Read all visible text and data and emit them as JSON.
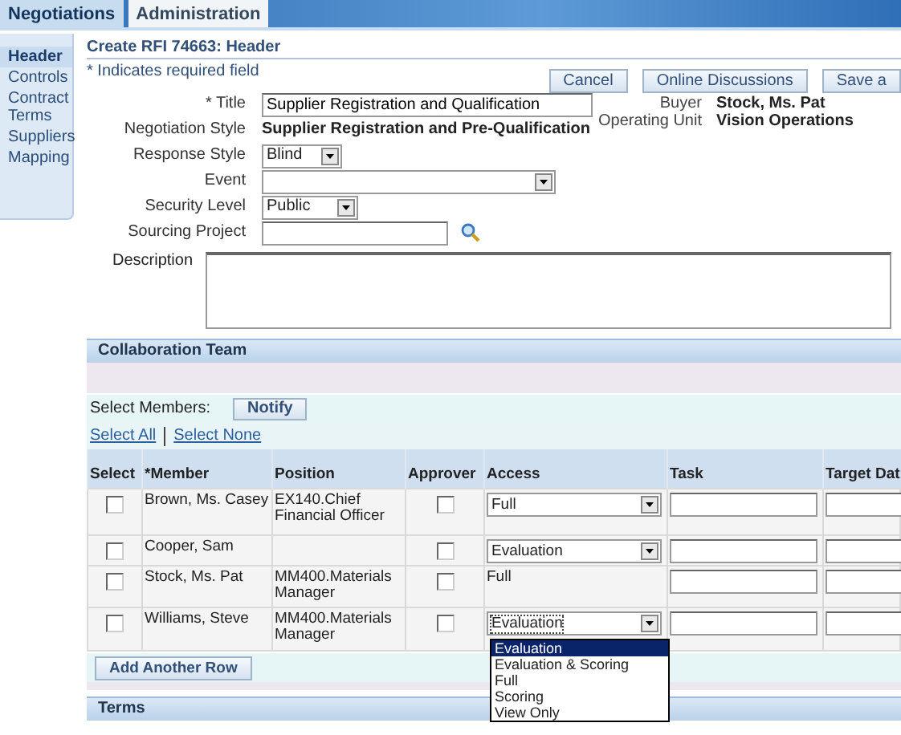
{
  "tabs": [
    {
      "label": "Negotiations",
      "selected": true
    },
    {
      "label": "Administration",
      "selected": false
    }
  ],
  "sidebar": {
    "items": [
      {
        "label": "Header",
        "selected": true
      },
      {
        "label": "Controls",
        "selected": false
      },
      {
        "label": "Contract Terms",
        "selected": false
      },
      {
        "label": "Suppliers",
        "selected": false
      },
      {
        "label": "Mapping",
        "selected": false
      }
    ]
  },
  "page_title": "Create RFI 74663: Header",
  "required_note": "* Indicates required field",
  "buttons": [
    "Cancel",
    "Online Discussions",
    "Save a"
  ],
  "form": {
    "fields": [
      {
        "kind": "input",
        "label": "* Title",
        "value": "Supplier Registration and Qualification"
      },
      {
        "kind": "text",
        "label": "Negotiation Style",
        "value": "Supplier Registration and Pre-Qualification"
      },
      {
        "kind": "select",
        "label": "Response Style",
        "value": "Blind"
      },
      {
        "kind": "select",
        "label": "Event"
      },
      {
        "kind": "select",
        "label": "Security Level",
        "value": "Public"
      },
      {
        "kind": "lookup",
        "label": "Sourcing Project"
      }
    ],
    "info": [
      {
        "label": "Buyer",
        "value": "Stock, Ms. Pat"
      },
      {
        "label": "Operating Unit",
        "value": "Vision Operations"
      }
    ],
    "description": {
      "label": "Description"
    }
  },
  "collaboration_team": {
    "title": "Collaboration Team",
    "select_members_label": "Select Members:",
    "notify_button": "Notify",
    "links": [
      "Select All",
      "Select None"
    ],
    "columns": [
      "Select",
      "*Member",
      "Position",
      "Approver",
      "Access",
      "Task",
      "Target Dat"
    ],
    "rows": [
      {
        "checked": false,
        "member": "Brown, Ms. Casey",
        "position": "EX140.Chief Financial Officer",
        "approver": false,
        "access": {
          "kind": "select",
          "value": "Full",
          "open": false
        }
      },
      {
        "checked": false,
        "member": "Cooper, Sam",
        "approver": false,
        "access": {
          "kind": "select",
          "value": "Evaluation",
          "open": false
        }
      },
      {
        "checked": false,
        "member": "Stock, Ms. Pat",
        "position": "MM400.Materials Manager",
        "approver": false,
        "access": {
          "kind": "text",
          "value": "Full"
        }
      },
      {
        "checked": false,
        "member": "Williams, Steve",
        "position": "MM400.Materials Manager",
        "approver": false,
        "access": {
          "kind": "select",
          "value": "Evaluation",
          "open": true,
          "options": [
            {
              "label": "Evaluation",
              "selected": true
            },
            {
              "label": "Evaluation & Scoring",
              "selected": false
            },
            {
              "label": "Full",
              "selected": false
            },
            {
              "label": "Scoring",
              "selected": false
            },
            {
              "label": "View Only",
              "selected": false
            }
          ]
        }
      }
    ],
    "add_row_button": "Add Another Row"
  },
  "terms": {
    "title": "Terms"
  }
}
